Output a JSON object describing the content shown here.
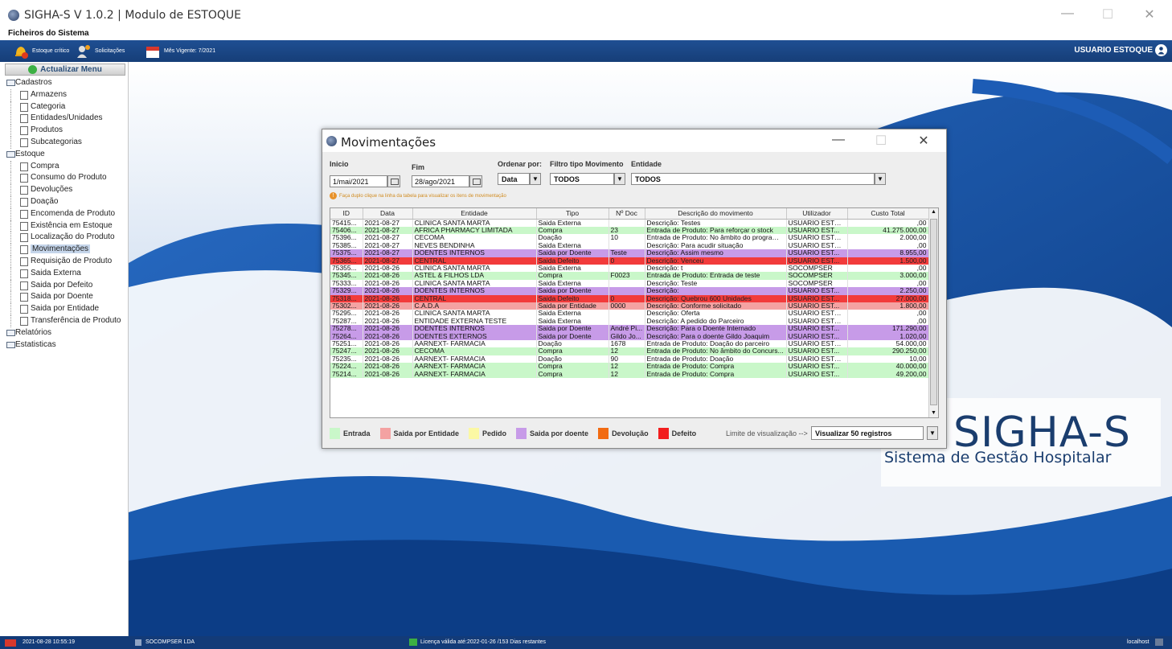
{
  "window": {
    "title": "SIGHA-S V 1.0.2 | Modulo de ESTOQUE",
    "minimize": "—",
    "maximize": "☐",
    "close": "✕"
  },
  "menubar": {
    "label": "Ficheiros do Sistema"
  },
  "toolbar": {
    "estoque_critico": "Estoque crítico",
    "estoque_critico_badge": "1",
    "solicitacoes": "Solicitações",
    "mes_vigente": "Mês Vigente: 7/2021",
    "user": "USUARIO ESTOQUE"
  },
  "sidebar": {
    "refresh_label": "Actualizar Menu",
    "groups": [
      {
        "label": "Cadastros",
        "items": [
          "Armazens",
          "Categoria",
          "Entidades/Unidades",
          "Produtos",
          "Subcategorias"
        ]
      },
      {
        "label": "Estoque",
        "items": [
          "Compra",
          "Consumo do Produto",
          "Devoluções",
          "Doação",
          "Encomenda de Produto",
          "Existência em Estoque",
          "Localização do Produto",
          "Movimentações",
          "Requisição de Produto",
          "Saida Externa",
          "Saida por Defeito",
          "Saida por Doente",
          "Saida por Entidade",
          "Transferência de Produto"
        ]
      },
      {
        "label": "Relatórios",
        "items": []
      },
      {
        "label": "Estatisticas",
        "items": []
      }
    ],
    "selected": "Movimentações"
  },
  "logo": {
    "title": "SIGHA-S",
    "subtitle": "Sistema de Gestão Hospitalar"
  },
  "dialog": {
    "title": "Movimentações",
    "filters": {
      "inicio_label": "Inicio",
      "inicio_value": "1/mai/2021",
      "fim_label": "Fim",
      "fim_value": "28/ago/2021",
      "ordenar_label": "Ordenar por:",
      "ordenar_value": "Data",
      "filtro_label": "Filtro tipo Movimento",
      "filtro_value": "TODOS",
      "entidade_label": "Entidade",
      "entidade_value": "TODOS"
    },
    "hint": "Faça duplo clique na linha da tabela para visualizar os itens de movimentação",
    "table": {
      "columns": [
        "ID",
        "Data",
        "Entidade",
        "Tipo",
        "Nº Doc",
        "Descrição do movimento",
        "Utilizador",
        "Custo Total"
      ],
      "rows": [
        {
          "color": "white",
          "cells": [
            "75415...",
            "2021-08-27",
            "CLINICA SANTA MARTA",
            "Saida Externa",
            "",
            "Descrição: Testes",
            "USUARIO ESTO...",
            ",00"
          ]
        },
        {
          "color": "green",
          "cells": [
            "75406...",
            "2021-08-27",
            "AFRICA PHARMACY LIMITADA",
            "Compra",
            "23",
            "Entrada de Produto: Para reforçar o stock",
            "USUARIO EST...",
            "41.275.000,00"
          ]
        },
        {
          "color": "white",
          "cells": [
            "75396...",
            "2021-08-27",
            "CECOMA",
            "Doação",
            "10",
            "Entrada de Produto: No âmbito do programa ...",
            "USUARIO ESTO...",
            "2.000,00"
          ]
        },
        {
          "color": "white",
          "cells": [
            "75385...",
            "2021-08-27",
            "NEVES BENDINHA",
            "Saida Externa",
            "",
            "Descrição: Para acudir situação",
            "USUARIO ESTO...",
            ",00"
          ]
        },
        {
          "color": "purple",
          "cells": [
            "75375...",
            "2021-08-27",
            "DOENTES INTERNOS",
            "Saida por Doente",
            "Teste",
            "Descrição: Assim mesmo",
            "USUARIO EST...",
            "8.955,00"
          ]
        },
        {
          "color": "red",
          "cells": [
            "75365...",
            "2021-08-27",
            "CENTRAL",
            "Saida Defeito",
            "0",
            "Descrição: Venceu",
            "USUARIO EST...",
            "1.500,00"
          ]
        },
        {
          "color": "white",
          "cells": [
            "75355...",
            "2021-08-26",
            "CLINICA SANTA MARTA",
            "Saida Externa",
            "",
            "Descrição: t",
            "SOCOMPSER",
            ",00"
          ]
        },
        {
          "color": "green",
          "cells": [
            "75345...",
            "2021-08-26",
            "ASTEL & FILHOS LDA",
            "Compra",
            "F0023",
            "Entrada de Produto: Entrada de teste",
            "SOCOMPSER",
            "3.000,00"
          ]
        },
        {
          "color": "white",
          "cells": [
            "75333...",
            "2021-08-26",
            "CLINICA SANTA MARTA",
            "Saida Externa",
            "",
            "Descrição: Teste",
            "SOCOMPSER",
            ",00"
          ]
        },
        {
          "color": "purple",
          "cells": [
            "75329...",
            "2021-08-26",
            "DOENTES INTERNOS",
            "Saida por Doente",
            "",
            "Descrição:",
            "USUARIO EST...",
            "2.250,00"
          ]
        },
        {
          "color": "red",
          "cells": [
            "75318...",
            "2021-08-26",
            "CENTRAL",
            "Saida Defeito",
            "0",
            "Descrição: Quebrou 600 Unidades",
            "USUARIO EST...",
            "27.000,00"
          ]
        },
        {
          "color": "pink",
          "cells": [
            "75302...",
            "2021-08-26",
            "C.A.D.A",
            "Saida por Entidade",
            "0000",
            "Descrição: Conforme solicitado",
            "USUARIO EST...",
            "1.800,00"
          ]
        },
        {
          "color": "white",
          "cells": [
            "75295...",
            "2021-08-26",
            "CLINICA SANTA MARTA",
            "Saida Externa",
            "",
            "Descrição: Oferta",
            "USUARIO ESTO...",
            ",00"
          ]
        },
        {
          "color": "white",
          "cells": [
            "75287...",
            "2021-08-26",
            "ENTIDADE EXTERNA TESTE",
            "Saida Externa",
            "",
            "Descrição: A pedido do Parceiro",
            "USUARIO ESTO...",
            ",00"
          ]
        },
        {
          "color": "purple",
          "cells": [
            "75278...",
            "2021-08-26",
            "DOENTES INTERNOS",
            "Saida por Doente",
            "André Pi...",
            "Descrição: Para o Doente Internado",
            "USUARIO EST...",
            "171.290,00"
          ]
        },
        {
          "color": "purple",
          "cells": [
            "75264...",
            "2021-08-26",
            "DOENTES EXTERNOS",
            "Saida por Doente",
            "Gildo Jo...",
            "Descrição: Para o doente Gildo Joaquim",
            "USUARIO EST...",
            "1.020,00"
          ]
        },
        {
          "color": "white",
          "cells": [
            "75251...",
            "2021-08-26",
            "AARNEXT- FARMACIA",
            "Doação",
            "1678",
            "Entrada de Produto: Doação do parceiro",
            "USUARIO ESTO...",
            "54.000,00"
          ]
        },
        {
          "color": "green",
          "cells": [
            "75247...",
            "2021-08-26",
            "CECOMA",
            "Compra",
            "12",
            "Entrada de Produto: No âmbito do Concurs...",
            "USUARIO EST...",
            "290.250,00"
          ]
        },
        {
          "color": "white",
          "cells": [
            "75235...",
            "2021-08-26",
            "AARNEXT- FARMACIA",
            "Doação",
            "90",
            "Entrada de Produto: Doação",
            "USUARIO ESTO...",
            "10,00"
          ]
        },
        {
          "color": "green",
          "cells": [
            "75224...",
            "2021-08-26",
            "AARNEXT- FARMACIA",
            "Compra",
            "12",
            "Entrada de Produto: Compra",
            "USUARIO EST...",
            "40.000,00"
          ]
        },
        {
          "color": "green",
          "cells": [
            "75214...",
            "2021-08-26",
            "AARNEXT- FARMACIA",
            "Compra",
            "12",
            "Entrada de Produto: Compra",
            "USUARIO EST...",
            "49.200,00"
          ]
        }
      ]
    },
    "legend": [
      {
        "label": "Entrada",
        "color": "#c9f7c9"
      },
      {
        "label": "Saida por Entidade",
        "color": "#f4a2a2"
      },
      {
        "label": "Pedido",
        "color": "#fbf8a4"
      },
      {
        "label": "Saida por doente",
        "color": "#c79be8"
      },
      {
        "label": "Devolução",
        "color": "#f26b12"
      },
      {
        "label": "Defeito",
        "color": "#f21e1e"
      }
    ],
    "limit_label": "Limite de visualização -->",
    "limit_value": "Visualizar 50 registros"
  },
  "statusbar": {
    "datetime": "2021-08-28 10:55:19",
    "company": "SOCOMPSER LDA",
    "license": "Licença válida até:2022-01-26 /153 Dias restantes",
    "host": "localhost"
  }
}
